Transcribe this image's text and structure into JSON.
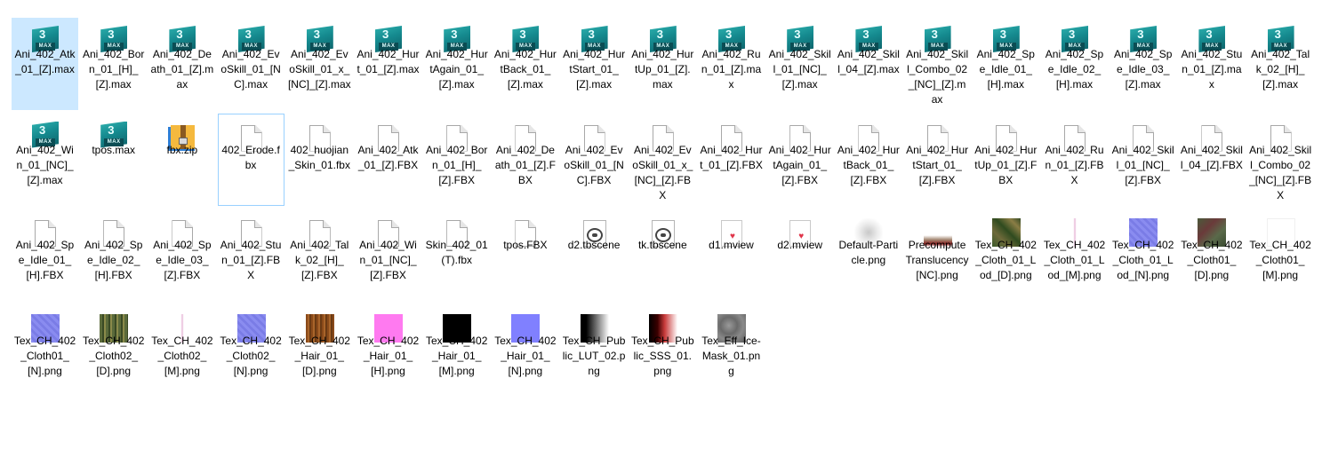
{
  "files": [
    {
      "name": "Ani_402_Atk_01_[Z].max",
      "icon": "3dsmax-file-icon",
      "selected": true
    },
    {
      "name": "Ani_402_Born_01_[H]_[Z].max",
      "icon": "3dsmax-file-icon"
    },
    {
      "name": "Ani_402_Death_01_[Z].max",
      "icon": "3dsmax-file-icon"
    },
    {
      "name": "Ani_402_EvoSkill_01_[NC].max",
      "icon": "3dsmax-file-icon"
    },
    {
      "name": "Ani_402_EvoSkill_01_x_[NC]_[Z].max",
      "icon": "3dsmax-file-icon"
    },
    {
      "name": "Ani_402_Hurt_01_[Z].max",
      "icon": "3dsmax-file-icon"
    },
    {
      "name": "Ani_402_HurtAgain_01_[Z].max",
      "icon": "3dsmax-file-icon"
    },
    {
      "name": "Ani_402_HurtBack_01_[Z].max",
      "icon": "3dsmax-file-icon"
    },
    {
      "name": "Ani_402_HurtStart_01_[Z].max",
      "icon": "3dsmax-file-icon"
    },
    {
      "name": "Ani_402_HurtUp_01_[Z].max",
      "icon": "3dsmax-file-icon"
    },
    {
      "name": "Ani_402_Run_01_[Z].max",
      "icon": "3dsmax-file-icon"
    },
    {
      "name": "Ani_402_Skill_01_[NC]_[Z].max",
      "icon": "3dsmax-file-icon"
    },
    {
      "name": "Ani_402_Skill_04_[Z].max",
      "icon": "3dsmax-file-icon"
    },
    {
      "name": "Ani_402_Skill_Combo_02_[NC]_[Z].max",
      "icon": "3dsmax-file-icon"
    },
    {
      "name": "Ani_402_Spe_Idle_01_[H].max",
      "icon": "3dsmax-file-icon"
    },
    {
      "name": "Ani_402_Spe_Idle_02_[H].max",
      "icon": "3dsmax-file-icon"
    },
    {
      "name": "Ani_402_Spe_Idle_03_[Z].max",
      "icon": "3dsmax-file-icon"
    },
    {
      "name": "Ani_402_Stun_01_[Z].max",
      "icon": "3dsmax-file-icon"
    },
    {
      "name": "Ani_402_Talk_02_[H]_[Z].max",
      "icon": "3dsmax-file-icon"
    },
    {
      "name": "Ani_402_Win_01_[NC]_[Z].max",
      "icon": "3dsmax-file-icon"
    },
    {
      "name": "tpos.max",
      "icon": "3dsmax-file-icon"
    },
    {
      "name": "fbx.zip",
      "icon": "zip-archive-icon"
    },
    {
      "name": "402_Erode.fbx",
      "icon": "document-icon",
      "focused": true
    },
    {
      "name": "402_huojian_Skin_01.fbx",
      "icon": "document-icon"
    },
    {
      "name": "Ani_402_Atk_01_[Z].FBX",
      "icon": "document-icon"
    },
    {
      "name": "Ani_402_Born_01_[H]_[Z].FBX",
      "icon": "document-icon"
    },
    {
      "name": "Ani_402_Death_01_[Z].FBX",
      "icon": "document-icon"
    },
    {
      "name": "Ani_402_EvoSkill_01_[NC].FBX",
      "icon": "document-icon"
    },
    {
      "name": "Ani_402_EvoSkill_01_x_[NC]_[Z].FBX",
      "icon": "document-icon"
    },
    {
      "name": "Ani_402_Hurt_01_[Z].FBX",
      "icon": "document-icon"
    },
    {
      "name": "Ani_402_HurtAgain_01_[Z].FBX",
      "icon": "document-icon"
    },
    {
      "name": "Ani_402_HurtBack_01_[Z].FBX",
      "icon": "document-icon"
    },
    {
      "name": "Ani_402_HurtStart_01_[Z].FBX",
      "icon": "document-icon"
    },
    {
      "name": "Ani_402_HurtUp_01_[Z].FBX",
      "icon": "document-icon"
    },
    {
      "name": "Ani_402_Run_01_[Z].FBX",
      "icon": "document-icon"
    },
    {
      "name": "Ani_402_Skill_01_[NC]_[Z].FBX",
      "icon": "document-icon"
    },
    {
      "name": "Ani_402_Skill_04_[Z].FBX",
      "icon": "document-icon"
    },
    {
      "name": "Ani_402_Skill_Combo_02_[NC]_[Z].FBX",
      "icon": "document-icon"
    },
    {
      "name": "Ani_402_Spe_Idle_01_[H].FBX",
      "icon": "document-icon"
    },
    {
      "name": "Ani_402_Spe_Idle_02_[H].FBX",
      "icon": "document-icon"
    },
    {
      "name": "Ani_402_Spe_Idle_03_[Z].FBX",
      "icon": "document-icon"
    },
    {
      "name": "Ani_402_Stun_01_[Z].FBX",
      "icon": "document-icon"
    },
    {
      "name": "Ani_402_Talk_02_[H]_[Z].FBX",
      "icon": "document-icon"
    },
    {
      "name": "Ani_402_Win_01_[NC]_[Z].FBX",
      "icon": "document-icon"
    },
    {
      "name": "Skin_402_01(T).fbx",
      "icon": "document-icon"
    },
    {
      "name": "tpos.FBX",
      "icon": "document-icon"
    },
    {
      "name": "d2.tbscene",
      "icon": "toolbag-scene-icon"
    },
    {
      "name": "tk.tbscene",
      "icon": "toolbag-scene-icon"
    },
    {
      "name": "d1.mview",
      "icon": "marmoset-viewer-icon"
    },
    {
      "name": "d2.mview",
      "icon": "marmoset-viewer-icon"
    },
    {
      "name": "Default-Particle.png",
      "icon": "image-thumbnail",
      "swatch": "sw-particle"
    },
    {
      "name": "PrecomputeTranslucency[NC].png",
      "icon": "image-thumbnail",
      "swatch": "sw-precomp"
    },
    {
      "name": "Tex_CH_402_Cloth_01_Lod_[D].png",
      "icon": "image-thumbnail",
      "swatch": "sw-cloth-d"
    },
    {
      "name": "Tex_CH_402_Cloth_01_Lod_[M].png",
      "icon": "image-thumbnail",
      "swatch": "sw-cloth-m"
    },
    {
      "name": "Tex_CH_402_Cloth_01_Lod_[N].png",
      "icon": "image-thumbnail",
      "swatch": "sw-normal"
    },
    {
      "name": "Tex_CH_402_Cloth01_[D].png",
      "icon": "image-thumbnail",
      "swatch": "sw-clothD2"
    },
    {
      "name": "Tex_CH_402_Cloth01_[M].png",
      "icon": "image-thumbnail",
      "swatch": "sw-blank2"
    },
    {
      "name": "Tex_CH_402_Cloth01_[N].png",
      "icon": "image-thumbnail",
      "swatch": "sw-normal"
    },
    {
      "name": "Tex_CH_402_Cloth02_[D].png",
      "icon": "image-thumbnail",
      "swatch": "sw-cloth02d"
    },
    {
      "name": "Tex_CH_402_Cloth02_[M].png",
      "icon": "image-thumbnail",
      "swatch": "sw-cloth-m"
    },
    {
      "name": "Tex_CH_402_Cloth02_[N].png",
      "icon": "image-thumbnail",
      "swatch": "sw-normal"
    },
    {
      "name": "Tex_CH_402_Hair_01_[D].png",
      "icon": "image-thumbnail",
      "swatch": "sw-hair-d"
    },
    {
      "name": "Tex_CH_402_Hair_01_[H].png",
      "icon": "image-thumbnail",
      "swatch": "sw-hair-h"
    },
    {
      "name": "Tex_CH_402_Hair_01_[M].png",
      "icon": "image-thumbnail",
      "swatch": "sw-hair-m"
    },
    {
      "name": "Tex_CH_402_Hair_01_[N].png",
      "icon": "image-thumbnail",
      "swatch": "sw-hair-n"
    },
    {
      "name": "Tex_CH_Public_LUT_02.png",
      "icon": "image-thumbnail",
      "swatch": "sw-lut"
    },
    {
      "name": "Tex_CH_Public_SSS_01.png",
      "icon": "image-thumbnail",
      "swatch": "sw-sss"
    },
    {
      "name": "Tex_Eff_Ice-Mask_01.png",
      "icon": "image-thumbnail",
      "swatch": "sw-icemask"
    }
  ],
  "colors": {
    "selection_bg": "#cce8ff",
    "focus_border": "#99d1ff",
    "max_teal": "#158a8f"
  }
}
